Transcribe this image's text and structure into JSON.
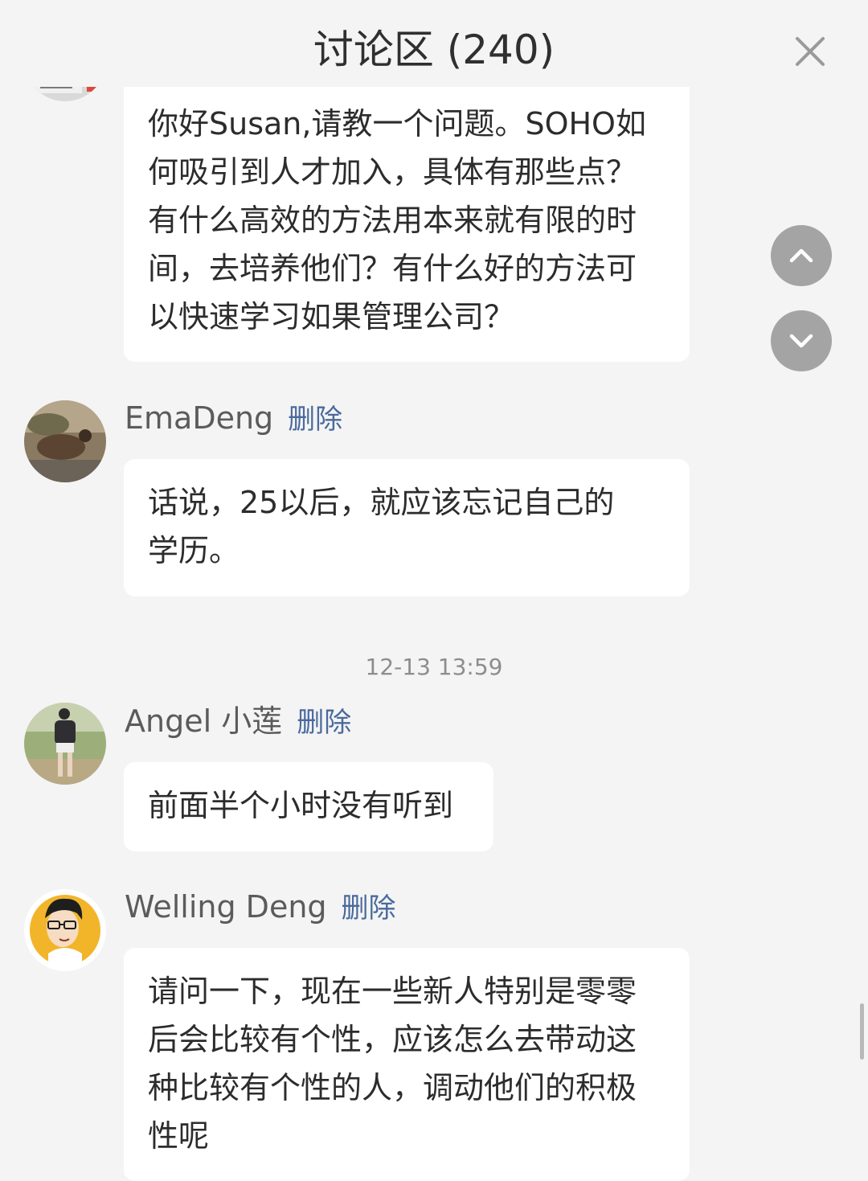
{
  "header": {
    "title": "讨论区 (240)"
  },
  "icons": {
    "close": "close-icon",
    "scroll_up": "chevron-up-icon",
    "scroll_down": "chevron-down-icon"
  },
  "messages": [
    {
      "author": "",
      "text_lines": [
        "你好Susan,请教一个问题。SOHO如",
        "何吸引到人才加入，具体有那些点？",
        "有什么高效的方法用本来就有限的时",
        "间，去培养他们？有什么好的方法可",
        "以快速学习如果管理公司？"
      ]
    },
    {
      "author": "EmaDeng",
      "delete_label": "删除",
      "text_lines": [
        "话说，25以后，就应该忘记自己的",
        "学历。"
      ]
    },
    {
      "timestamp": "12-13 13:59"
    },
    {
      "author": "Angel 小莲",
      "delete_label": "删除",
      "text_lines": [
        "前面半个小时没有听到"
      ]
    },
    {
      "author": "Welling Deng",
      "delete_label": "删除",
      "text_lines": [
        "请问一下，现在一些新人特别是零零",
        "后会比较有个性，应该怎么去带动这",
        "种比较有个性的人，调动他们的积极",
        "性呢"
      ]
    }
  ],
  "colors": {
    "background": "#f4f4f5",
    "bubble": "#ffffff",
    "delete_link": "#4a6a9c",
    "nav_button": "#a4a4a4"
  }
}
